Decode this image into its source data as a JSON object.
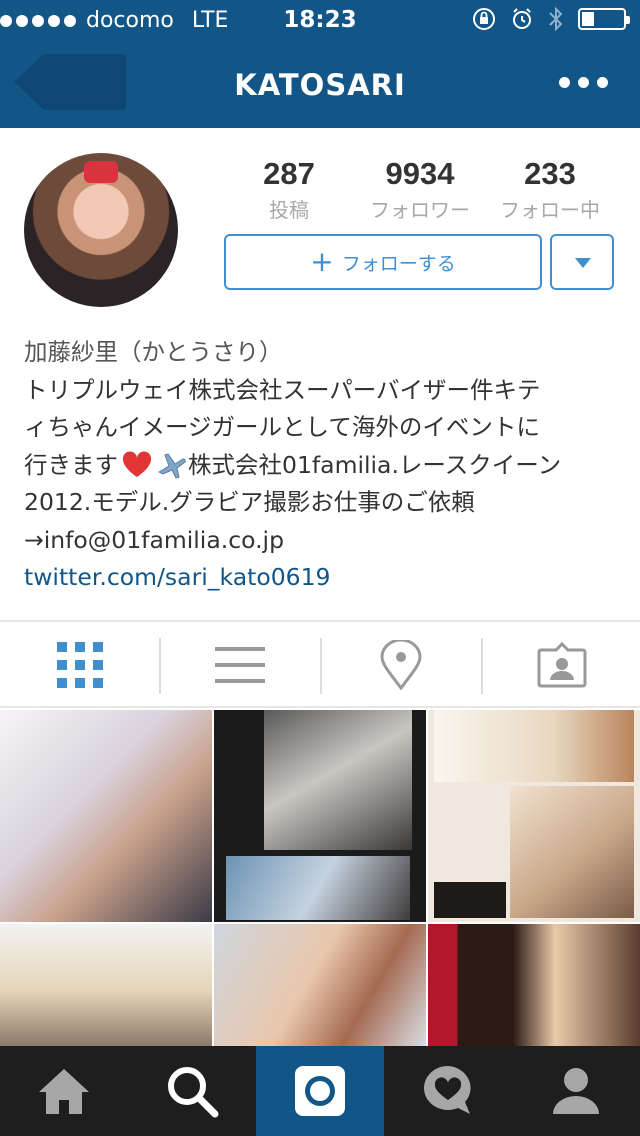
{
  "status_bar": {
    "carrier": "docomo",
    "network": "LTE",
    "time": "18:23",
    "battery_level": 0.3
  },
  "nav": {
    "title": "KATOSARI",
    "back_icon": "back-arrow-icon",
    "more_icon": "more-dots-icon"
  },
  "profile": {
    "stats": [
      {
        "value": "287",
        "label": "投稿"
      },
      {
        "value": "9934",
        "label": "フォロワー"
      },
      {
        "value": "233",
        "label": "フォロー中"
      }
    ],
    "follow_label": "フォローする",
    "bio_name": "加藤紗里（かとうさり）",
    "bio_line1": "トリプルウェイ株式会社スーパーバイザー件キテ",
    "bio_line2": "ィちゃんイメージガールとして海外のイベントに",
    "bio_line3_a": "行きます",
    "bio_line3_b": " 株式会社01familia.レースクイーン",
    "bio_line4": "2012.モデル.グラビア撮影お仕事のご依頼",
    "bio_line5": "→info@01familia.co.jp",
    "link": "twitter.com/sari_kato0619"
  },
  "colors": {
    "brand": "#125688",
    "accent": "#3f8fd1",
    "muted": "#a8a8a8"
  },
  "tabs": [
    "grid-view-icon",
    "list-view-icon",
    "location-icon",
    "tagged-photos-icon"
  ],
  "bottom_nav": [
    "home-icon",
    "search-icon",
    "camera-icon",
    "activity-heart-icon",
    "profile-icon"
  ]
}
